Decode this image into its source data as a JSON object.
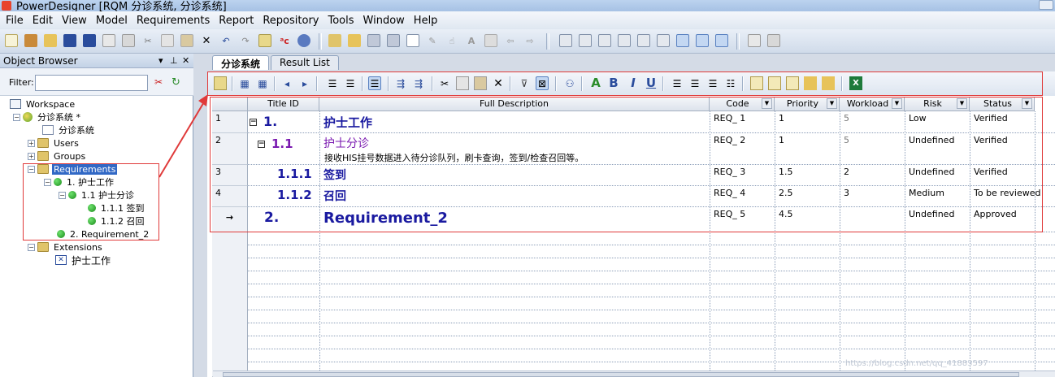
{
  "window": {
    "title": "PowerDesigner [RQM 分诊系统, 分诊系统]"
  },
  "menubar": [
    "File",
    "Edit",
    "View",
    "Model",
    "Requirements",
    "Report",
    "Repository",
    "Tools",
    "Window",
    "Help"
  ],
  "object_browser": {
    "title": "Object Browser",
    "controls": [
      "▾",
      "⊥",
      "✕"
    ],
    "filter_label": "Filter:",
    "filter_value": "",
    "tree": [
      {
        "label": "Workspace",
        "icon": "workspace-icon"
      },
      {
        "label": "分诊系统 *",
        "icon": "model-icon"
      },
      {
        "label": "分诊系统",
        "icon": "document-icon"
      },
      {
        "label": "Users",
        "icon": "folder-icon"
      },
      {
        "label": "Groups",
        "icon": "folder-icon"
      },
      {
        "label": "Requirements",
        "icon": "folder-icon",
        "selected": true
      },
      {
        "label": "1. 护士工作",
        "icon": "requirement-ball-icon"
      },
      {
        "label": "1.1 护士分诊",
        "icon": "requirement-ball-icon"
      },
      {
        "label": "1.1.1 签到",
        "icon": "requirement-ball-icon"
      },
      {
        "label": "1.1.2 召回",
        "icon": "requirement-ball-icon"
      },
      {
        "label": "2. Requirement_2",
        "icon": "requirement-ball-icon"
      },
      {
        "label": "Extensions",
        "icon": "folder-icon"
      },
      {
        "label": "护士工作",
        "icon": "traceability-doc-icon"
      }
    ]
  },
  "tabs": [
    {
      "label": "分诊系统",
      "active": true
    },
    {
      "label": "Result List",
      "active": false
    }
  ],
  "grid": {
    "columns": [
      "Title ID",
      "Full Description",
      "Code",
      "Priority",
      "Workload",
      "Risk",
      "Status"
    ],
    "rows": [
      {
        "num": "1",
        "title_id": "1.",
        "title": "护士工作",
        "description": "",
        "code": "REQ_ 1",
        "priority": "1",
        "workload": "5",
        "risk": "Low",
        "status": "Verified"
      },
      {
        "num": "2",
        "title_id": "1.1",
        "title": "护士分诊",
        "description": "接收HIS挂号数据进入待分诊队列，刷卡查询，签到/检查召回等。",
        "code": "REQ_ 2",
        "priority": "1",
        "workload": "5",
        "risk": "Undefined",
        "status": "Verified"
      },
      {
        "num": "3",
        "title_id": "1.1.1",
        "title": "签到",
        "description": "",
        "code": "REQ_ 3",
        "priority": "1.5",
        "workload": "2",
        "risk": "Undefined",
        "status": "Verified"
      },
      {
        "num": "4",
        "title_id": "1.1.2",
        "title": "召回",
        "description": "",
        "code": "REQ_ 4",
        "priority": "2.5",
        "workload": "3",
        "risk": "Medium",
        "status": "To be reviewed"
      },
      {
        "num": "→",
        "title_id": "2.",
        "title": "Requirement_2",
        "description": "",
        "code": "REQ_ 5",
        "priority": "4.5",
        "workload": "",
        "risk": "Undefined",
        "status": "Approved"
      }
    ]
  },
  "watermark": "https://blog.csdn.net/qq_41883597",
  "colors": {
    "annotation": "#e03a3a",
    "title_blue": "#1a1aa0",
    "title_purple": "#7a1ab0"
  }
}
